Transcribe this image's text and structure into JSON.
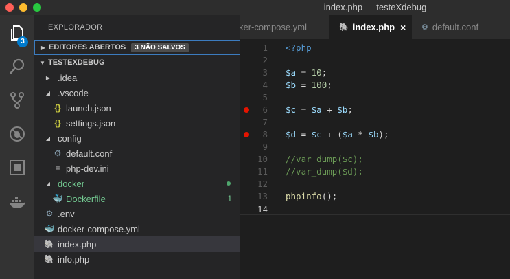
{
  "window": {
    "title": "index.php — testeXdebug"
  },
  "activity_bar": {
    "items": [
      {
        "icon": "files-icon",
        "badge": "3"
      },
      {
        "icon": "search-icon"
      },
      {
        "icon": "source-control-icon"
      },
      {
        "icon": "debug-icon"
      },
      {
        "icon": "extensions-icon"
      },
      {
        "icon": "docker-icon"
      }
    ],
    "explorer_badge": "3"
  },
  "sidebar": {
    "title": "EXPLORADOR",
    "open_editors": {
      "label": "EDITORES ABERTOS",
      "badge": "3 NÃO SALVOS"
    },
    "project": {
      "label": "TESTEXDEBUG"
    },
    "tree": [
      {
        "label": ".idea",
        "depth": 1,
        "twisty": "collapsed",
        "icon": ""
      },
      {
        "label": ".vscode",
        "depth": 1,
        "twisty": "expanded",
        "icon": ""
      },
      {
        "label": "launch.json",
        "depth": 2,
        "icon": "json-icon",
        "glyph": "{}"
      },
      {
        "label": "settings.json",
        "depth": 2,
        "icon": "json-icon",
        "glyph": "{}"
      },
      {
        "label": "config",
        "depth": 1,
        "twisty": "expanded",
        "icon": ""
      },
      {
        "label": "default.conf",
        "depth": 2,
        "icon": "gear-icon",
        "glyph": "⚙"
      },
      {
        "label": "php-dev.ini",
        "depth": 2,
        "icon": "ini-file-icon",
        "glyph": "≡"
      },
      {
        "label": "docker",
        "depth": 1,
        "twisty": "expanded",
        "icon": "",
        "git": true,
        "dot": true
      },
      {
        "label": "Dockerfile",
        "depth": 2,
        "icon": "docker-file-icon",
        "glyph": "🐳",
        "git": true,
        "count": "1"
      },
      {
        "label": ".env",
        "depth": 1,
        "icon": "gear-icon",
        "glyph": "⚙"
      },
      {
        "label": "docker-compose.yml",
        "depth": 1,
        "icon": "yml-icon",
        "glyph": "🐳"
      },
      {
        "label": "index.php",
        "depth": 1,
        "icon": "php-icon",
        "glyph": "🐘",
        "selected": true
      },
      {
        "label": "info.php",
        "depth": 1,
        "icon": "php-icon",
        "glyph": "🐘"
      }
    ]
  },
  "tabs": [
    {
      "label": "docker-compose.yml",
      "visible_label": "ker-compose.yml",
      "active": false
    },
    {
      "label": "index.php",
      "active": true,
      "icon": "php-icon",
      "close": "×"
    },
    {
      "label": "default.conf",
      "active": false,
      "icon": "gear-icon"
    }
  ],
  "editor": {
    "active_line": 14,
    "breakpoints": [
      6,
      8
    ],
    "lines": [
      {
        "n": "1",
        "tokens": [
          [
            "tag",
            "<?php"
          ]
        ]
      },
      {
        "n": "2",
        "tokens": []
      },
      {
        "n": "3",
        "tokens": [
          [
            "var",
            "$a"
          ],
          [
            "plain",
            " = "
          ],
          [
            "num",
            "10"
          ],
          [
            "plain",
            ";"
          ]
        ]
      },
      {
        "n": "4",
        "tokens": [
          [
            "var",
            "$b"
          ],
          [
            "plain",
            " = "
          ],
          [
            "num",
            "100"
          ],
          [
            "plain",
            ";"
          ]
        ]
      },
      {
        "n": "5",
        "tokens": []
      },
      {
        "n": "6",
        "tokens": [
          [
            "var",
            "$c"
          ],
          [
            "plain",
            " = "
          ],
          [
            "var",
            "$a"
          ],
          [
            "plain",
            " + "
          ],
          [
            "var",
            "$b"
          ],
          [
            "plain",
            ";"
          ]
        ]
      },
      {
        "n": "7",
        "tokens": []
      },
      {
        "n": "8",
        "tokens": [
          [
            "var",
            "$d"
          ],
          [
            "plain",
            " = "
          ],
          [
            "var",
            "$c"
          ],
          [
            "plain",
            " + ("
          ],
          [
            "var",
            "$a"
          ],
          [
            "plain",
            " * "
          ],
          [
            "var",
            "$b"
          ],
          [
            "plain",
            ");"
          ]
        ]
      },
      {
        "n": "9",
        "tokens": []
      },
      {
        "n": "10",
        "tokens": [
          [
            "comment",
            "//var_dump($c);"
          ]
        ]
      },
      {
        "n": "11",
        "tokens": [
          [
            "comment",
            "//var_dump($d);"
          ]
        ]
      },
      {
        "n": "12",
        "tokens": []
      },
      {
        "n": "13",
        "tokens": [
          [
            "fn",
            "phpinfo"
          ],
          [
            "plain",
            "();"
          ]
        ]
      },
      {
        "n": "14",
        "tokens": []
      }
    ]
  },
  "colors": {
    "accent": "#007acc",
    "git_untracked": "#73c991",
    "breakpoint": "#e51400"
  }
}
